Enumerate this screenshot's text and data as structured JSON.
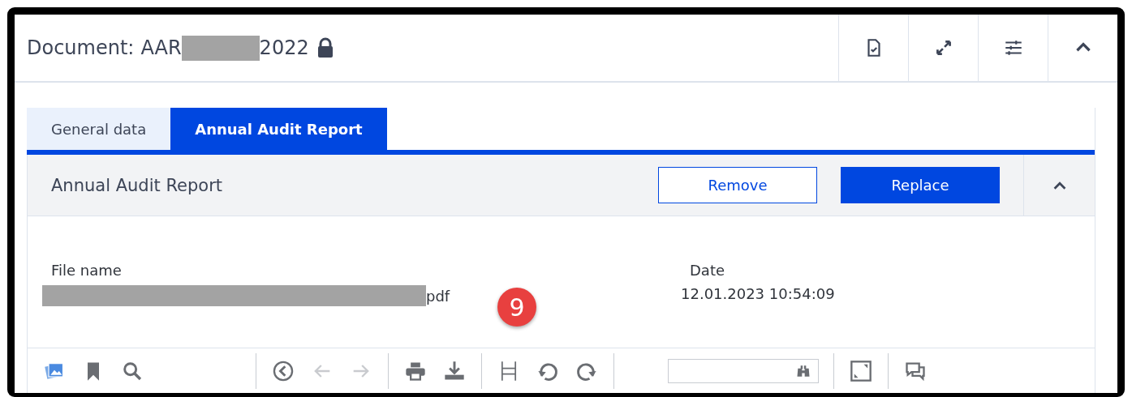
{
  "header": {
    "label": "Document:",
    "code_prefix": "AAR",
    "code_suffix": "2022",
    "locked": true,
    "actions": [
      {
        "kind": "document-check"
      },
      {
        "kind": "expand"
      },
      {
        "kind": "sliders"
      },
      {
        "kind": "chevron-up"
      }
    ]
  },
  "tabs": [
    {
      "label": "General data",
      "selected": false
    },
    {
      "label": "Annual Audit Report",
      "selected": true
    }
  ],
  "section": {
    "title": "Annual Audit Report",
    "buttons": [
      {
        "label": "Remove",
        "kind": "outline"
      },
      {
        "label": "Replace",
        "kind": "primary"
      }
    ],
    "expanded": true,
    "fields": [
      {
        "label": "File name",
        "value": "pdf",
        "redacted": true
      },
      {
        "label": "Date",
        "value": "12.01.2023 10:54:09"
      }
    ],
    "badge": "9"
  },
  "toolbar": [
    [
      {
        "kind": "thumbnails"
      },
      {
        "kind": "bookmark"
      },
      {
        "kind": "search"
      }
    ],
    [
      {
        "kind": "circle-back"
      },
      {
        "kind": "arrow-left",
        "disabled": true
      },
      {
        "kind": "arrow-right",
        "disabled": true
      }
    ],
    [
      {
        "kind": "print"
      },
      {
        "kind": "download"
      }
    ],
    [
      {
        "kind": "page-fit"
      },
      {
        "kind": "rotate-left"
      },
      {
        "kind": "rotate-right"
      }
    ],
    [
      {
        "kind": "find-field"
      }
    ],
    [
      {
        "kind": "fullscreen"
      }
    ],
    [
      {
        "kind": "comments"
      }
    ]
  ]
}
